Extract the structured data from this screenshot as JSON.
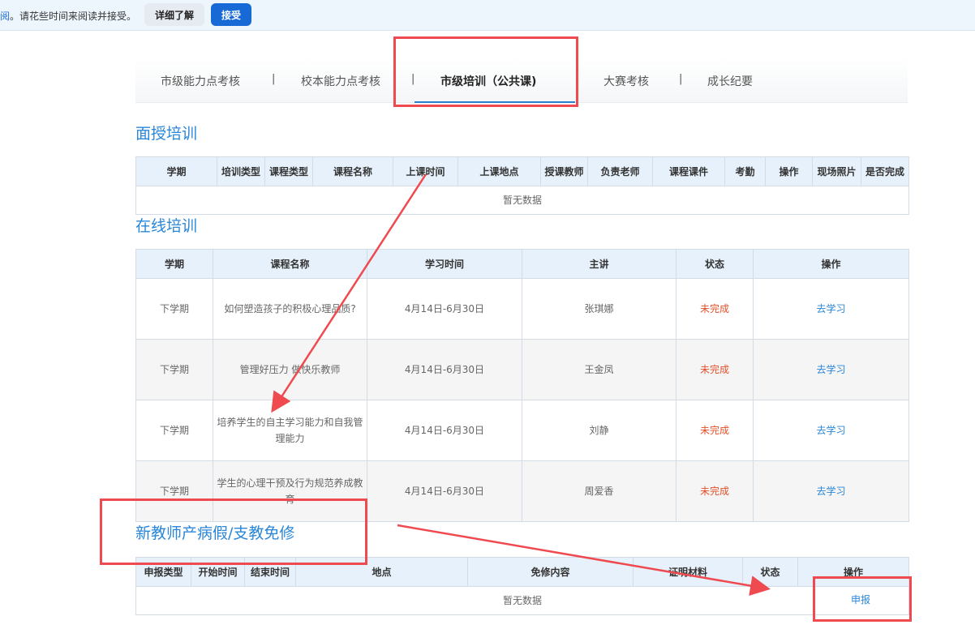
{
  "notice": {
    "lead": "阅",
    "text": "。请花些时间来阅读并接受。",
    "detail_label": "详细了解",
    "accept_label": "接受"
  },
  "tabs": [
    {
      "label": "市级能力点考核"
    },
    {
      "label": "校本能力点考核"
    },
    {
      "label": "市级培训（公共课)"
    },
    {
      "label": "大赛考核"
    },
    {
      "label": "成长纪要"
    }
  ],
  "separator": "|",
  "face_training": {
    "title": "面授培训",
    "headers": [
      "学期",
      "培训类型",
      "课程类型",
      "课程名称",
      "上课时间",
      "上课地点",
      "授课教师",
      "负责老师",
      "课程课件",
      "考勤",
      "操作",
      "现场照片",
      "是否完成"
    ],
    "empty": "暂无数据"
  },
  "online_training": {
    "title": "在线培训",
    "headers": [
      "学期",
      "课程名称",
      "学习时间",
      "主讲",
      "状态",
      "操作"
    ],
    "rows": [
      {
        "term": "下学期",
        "course": "如何塑造孩子的积极心理品质?",
        "time": "4月14日-6月30日",
        "speaker": "张琪娜",
        "status": "未完成",
        "action": "去学习"
      },
      {
        "term": "下学期",
        "course": "管理好压力 做快乐教师",
        "time": "4月14日-6月30日",
        "speaker": "王金凤",
        "status": "未完成",
        "action": "去学习"
      },
      {
        "term": "下学期",
        "course": "培养学生的自主学习能力和自我管理能力",
        "time": "4月14日-6月30日",
        "speaker": "刘静",
        "status": "未完成",
        "action": "去学习"
      },
      {
        "term": "下学期",
        "course": "学生的心理干预及行为规范养成教育",
        "time": "4月14日-6月30日",
        "speaker": "周爱香",
        "status": "未完成",
        "action": "去学习"
      }
    ]
  },
  "new_teacher": {
    "title": "新教师产病假/支教免修",
    "headers": [
      "申报类型",
      "开始时间",
      "结束时间",
      "地点",
      "免修内容",
      "证明材料",
      "状态",
      "操作"
    ],
    "empty": "暂无数据",
    "apply_label": "申报"
  },
  "colors": {
    "accent": "#2a86d8",
    "status_red": "#e0502a",
    "annotation_red": "#ef4a4f",
    "header_bg": "#e7f1fb"
  }
}
